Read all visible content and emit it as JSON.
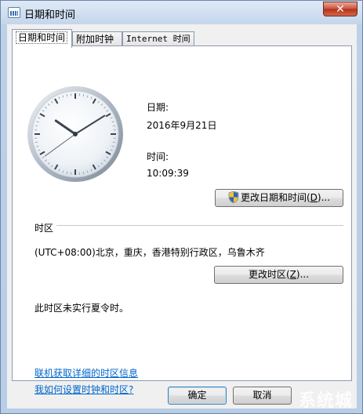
{
  "window": {
    "title": "日期和时间",
    "close_symbol": "✕"
  },
  "tabs": [
    {
      "label": "日期和时间",
      "active": true
    },
    {
      "label": "附加时钟",
      "active": false
    },
    {
      "label": "Internet 时间",
      "active": false
    }
  ],
  "datetime": {
    "date_label": "日期:",
    "date_value": "2016年9月21日",
    "time_label": "时间:",
    "time_value": "10:09:39",
    "change_button_label": "更改日期和时间(",
    "change_button_accel": "D",
    "change_button_suffix": ")..."
  },
  "clock": {
    "hour": 10,
    "minute": 9,
    "second": 39
  },
  "timezone": {
    "section_label": "时区",
    "value": "(UTC+08:00)北京，重庆，香港特别行政区，乌鲁木齐",
    "change_button_label": "更改时区(",
    "change_button_accel": "Z",
    "change_button_suffix": ")...",
    "dst_note": "此时区未实行夏令时。"
  },
  "links": {
    "online_info": "联机获取详细的时区信息",
    "how_to": "我如何设置时钟和时区?"
  },
  "footer": {
    "ok_label": "确定",
    "cancel_label": "取消"
  },
  "watermark": {
    "text": "系统城"
  },
  "colors": {
    "link": "#0066cc",
    "close_button": "#c94f35"
  },
  "icons": {
    "title_icon": "calendar-clock-icon",
    "uac_shield": "uac-shield-icon",
    "close": "close-icon"
  }
}
